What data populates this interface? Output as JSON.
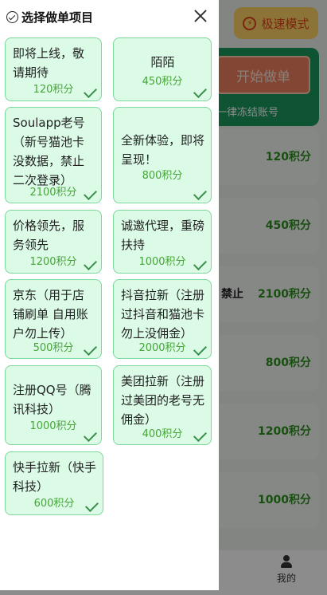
{
  "background": {
    "speed_mode_label": "极速模式",
    "start_button_label": "开始做单",
    "freeze_text": "一律冻结账号",
    "rows": [
      {
        "points": "120积分",
        "note": ""
      },
      {
        "points": "450积分",
        "note": ""
      },
      {
        "points": "2100积分",
        "note": "禁止"
      },
      {
        "points": "800积分",
        "note": ""
      },
      {
        "points": "1200积分",
        "note": ""
      },
      {
        "points": "1000积分",
        "note": ""
      }
    ],
    "nav_me_label": "我的"
  },
  "panel": {
    "title": "选择做单项目",
    "items": [
      {
        "title": "即将上线，敬请期待",
        "points": "120积分"
      },
      {
        "title": "陌陌",
        "points": "450积分"
      },
      {
        "title": "Soulapp老号（新号猫池卡没数据，禁止二次登录）",
        "points": "2100积分"
      },
      {
        "title": "全新体验，即将呈现！",
        "points": "800积分"
      },
      {
        "title": "价格领先，服务领先",
        "points": "1200积分"
      },
      {
        "title": "诚邀代理，重磅扶持",
        "points": "1000积分"
      },
      {
        "title": "京东（用于店铺刷单 自用账户勿上传）",
        "points": "500积分"
      },
      {
        "title": "抖音拉新（注册过抖音和猫池卡勿上没佣金）",
        "points": "2000积分"
      },
      {
        "title": "注册QQ号（腾讯科技）",
        "points": "1000积分"
      },
      {
        "title": "美团拉新（注册过美团的老号无佣金）",
        "points": "400积分"
      },
      {
        "title": "快手拉新（快手科技）",
        "points": "600积分"
      }
    ]
  }
}
